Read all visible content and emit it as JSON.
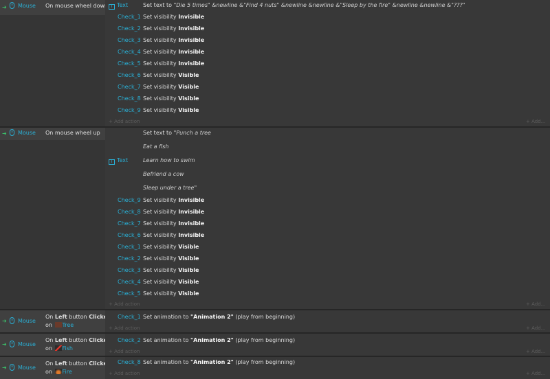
{
  "events": [
    {
      "condition": {
        "object": "Mouse",
        "text": "On mouse wheel down"
      },
      "actions": [
        {
          "object": "Text",
          "prefix": "Set text to ",
          "value": "\"Die 5 times\" &newline &\"Find 4 nuts\" &newline &newline &\"Sleep by the fire\" &newline &newline &\"???\""
        },
        {
          "object": "Check_1",
          "prefix": "Set visibility ",
          "value": "Invisible"
        },
        {
          "object": "Check_2",
          "prefix": "Set visibility ",
          "value": "Invisible"
        },
        {
          "object": "Check_3",
          "prefix": "Set visibility ",
          "value": "Invisible"
        },
        {
          "object": "Check_4",
          "prefix": "Set visibility ",
          "value": "Invisible"
        },
        {
          "object": "Check_5",
          "prefix": "Set visibility ",
          "value": "Invisible"
        },
        {
          "object": "Check_6",
          "prefix": "Set visibility ",
          "value": "Visible"
        },
        {
          "object": "Check_7",
          "prefix": "Set visibility ",
          "value": "Visible"
        },
        {
          "object": "Check_8",
          "prefix": "Set visibility ",
          "value": "Visible"
        },
        {
          "object": "Check_9",
          "prefix": "Set visibility ",
          "value": "Visible"
        }
      ],
      "add_action": "Add action",
      "add_more": "Add..."
    },
    {
      "condition": {
        "object": "Mouse",
        "text": "On mouse wheel up"
      },
      "text_action": {
        "object": "Text",
        "prefix": "Set text to ",
        "lines": [
          "\"Punch a tree",
          "Eat a fish",
          "Learn how to swim",
          "Befriend a cow",
          "Sleep under a tree\""
        ]
      },
      "actions": [
        {
          "object": "Check_9",
          "prefix": "Set visibility ",
          "value": "Invisible"
        },
        {
          "object": "Check_8",
          "prefix": "Set visibility ",
          "value": "Invisible"
        },
        {
          "object": "Check_7",
          "prefix": "Set visibility ",
          "value": "Invisible"
        },
        {
          "object": "Check_6",
          "prefix": "Set visibility ",
          "value": "Invisible"
        },
        {
          "object": "Check_1",
          "prefix": "Set visibility ",
          "value": "Visible"
        },
        {
          "object": "Check_2",
          "prefix": "Set visibility ",
          "value": "Visible"
        },
        {
          "object": "Check_3",
          "prefix": "Set visibility ",
          "value": "Visible"
        },
        {
          "object": "Check_4",
          "prefix": "Set visibility ",
          "value": "Visible"
        },
        {
          "object": "Check_5",
          "prefix": "Set visibility ",
          "value": "Visible"
        }
      ],
      "add_action": "Add action",
      "add_more": "Add..."
    },
    {
      "condition": {
        "object": "Mouse",
        "on": "On ",
        "button": "Left",
        "mid": " button ",
        "clicked": "Clicked",
        "on2": "on ",
        "target": "Tree"
      },
      "action": {
        "object": "Check_1",
        "prefix": "Set animation to ",
        "value": "\"Animation 2\"",
        "suffix": " (play from beginning)"
      },
      "add_action": "Add action",
      "add_more": "Add..."
    },
    {
      "condition": {
        "object": "Mouse",
        "on": "On ",
        "button": "Left",
        "mid": " button ",
        "clicked": "Clicked",
        "on2": "on ",
        "target": "Fish"
      },
      "action": {
        "object": "Check_2",
        "prefix": "Set animation to ",
        "value": "\"Animation 2\"",
        "suffix": " (play from beginning)"
      },
      "add_action": "Add action",
      "add_more": "Add..."
    },
    {
      "condition": {
        "object": "Mouse",
        "on": "On ",
        "button": "Left",
        "mid": " button ",
        "clicked": "Clicked",
        "on2": "on ",
        "target": "Fire"
      },
      "action": {
        "object": "Check_8",
        "prefix": "Set animation to ",
        "value": "\"Animation 2\"",
        "suffix": " (play from beginning)"
      },
      "add_action": "Add action",
      "add_more": "Add..."
    }
  ],
  "colors": {
    "object": "#2ab0d6",
    "enabled_arrow": "#3bbf6a",
    "background": "#2b2b2b"
  },
  "icons": {
    "condition_enabled": "arrow-right-icon",
    "mouse": "mouse-icon",
    "text_object": "text-object-icon",
    "tree_thumb": "tree-thumbnail",
    "fish_thumb": "fish-thumbnail",
    "fire_thumb": "fire-thumbnail"
  }
}
